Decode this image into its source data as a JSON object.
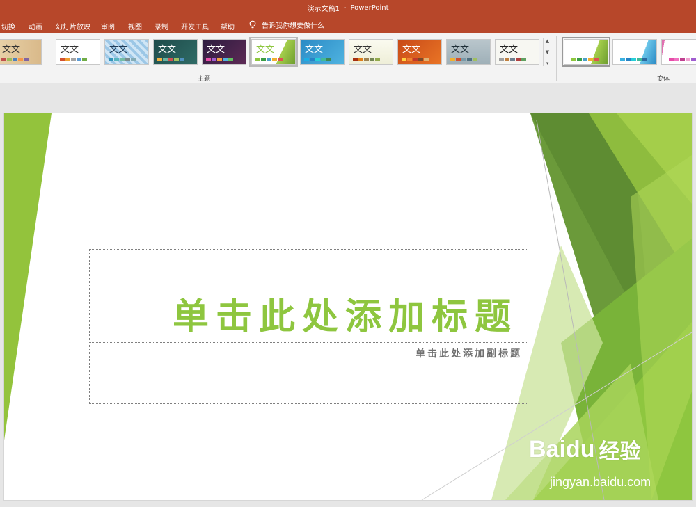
{
  "window": {
    "doc_title": "演示文稿1",
    "separator": "-",
    "app_name": "PowerPoint"
  },
  "menu": {
    "tabs": [
      "切换",
      "动画",
      "幻灯片放映",
      "审阅",
      "视图",
      "录制",
      "开发工具",
      "帮助"
    ],
    "tell_me": "告诉我你想要做什么"
  },
  "ribbon": {
    "theme_sample_text": "文文",
    "theme_group_label": "主题",
    "variant_group_label": "变体"
  },
  "slide": {
    "title": "单击此处添加标题",
    "subtitle": "单击此处添加副标题"
  },
  "watermark": {
    "brand": "Bai",
    "paw": "du",
    "cn": "经验",
    "url": "jingyan.baidu.com"
  },
  "colors": {
    "accent": "#8ec63f",
    "ribbon": "#b7472a"
  }
}
